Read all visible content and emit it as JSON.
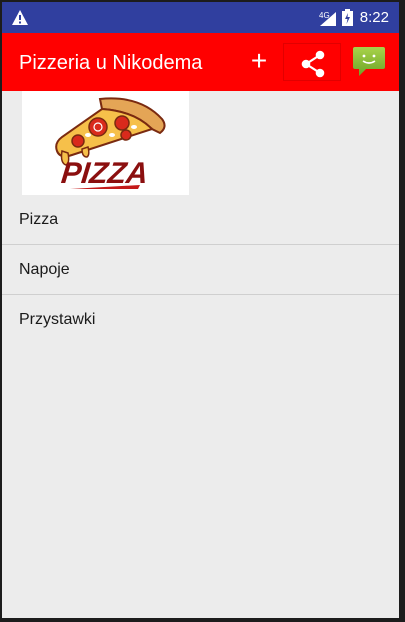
{
  "status_bar": {
    "network": "4G",
    "time": "8:22"
  },
  "app_bar": {
    "title": "Pizzeria u Nikodema",
    "add_label": "+",
    "icons": [
      "add-icon",
      "share-icon",
      "message-icon"
    ]
  },
  "logo": {
    "text": "PIZZA"
  },
  "menu": {
    "items": [
      {
        "label": "Pizza"
      },
      {
        "label": "Napoje"
      },
      {
        "label": "Przystawki"
      }
    ]
  },
  "colors": {
    "status_bar": "#303f9f",
    "app_bar": "#ff0000",
    "background": "#ececec"
  }
}
